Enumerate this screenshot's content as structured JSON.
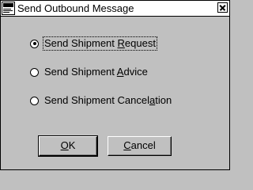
{
  "window": {
    "title": "Send Outbound Message",
    "icon": "app-logo-icon",
    "close_icon": "close-icon"
  },
  "options": [
    {
      "pre": "Send Shipment ",
      "key": "R",
      "post": "equest",
      "checked": true,
      "focused": true
    },
    {
      "pre": "Send Shipment ",
      "key": "A",
      "post": "dvice",
      "checked": false,
      "focused": false
    },
    {
      "pre": "Send Shipment Cancel",
      "key": "a",
      "post": "tion",
      "checked": false,
      "focused": false
    }
  ],
  "buttons": {
    "ok": {
      "key": "O",
      "rest": "K"
    },
    "cancel": {
      "key": "C",
      "rest": "ancel"
    }
  }
}
